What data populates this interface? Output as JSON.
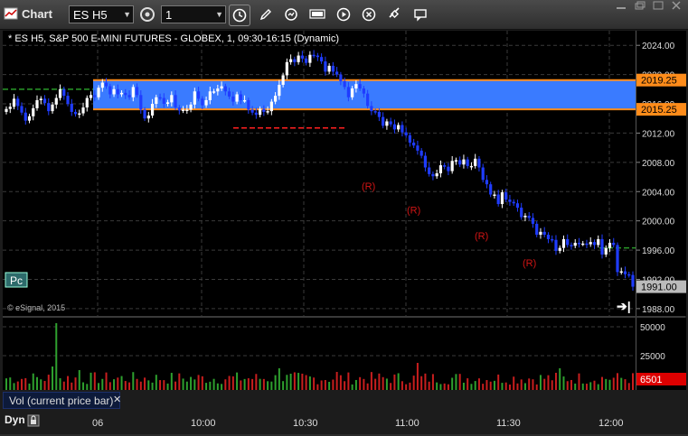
{
  "window": {
    "title": "Chart"
  },
  "toolbar": {
    "symbol": "ES H5",
    "interval": "1",
    "tools": [
      "properties-icon",
      "clock-icon",
      "draw-icon",
      "refresh-icon",
      "quote-icon",
      "play-icon",
      "search-icon",
      "link-icon",
      "message-icon"
    ]
  },
  "chart": {
    "header": "* ES H5, S&P 500 E-MINI FUTURES - GLOBEX, 1, 09:30-16:15 (Dynamic)",
    "copyright": "© eSignal, 2015",
    "pc_label": "Pc",
    "zone": {
      "upper": 2019.25,
      "lower": 2015.25,
      "color": "#3a7bff"
    },
    "last_price": "1991.00",
    "upper_label": "2019.25",
    "lower_label": "2015.25",
    "price_ticks": [
      "2024.00",
      "2020.00",
      "2016.00",
      "2012.00",
      "2008.00",
      "2004.00",
      "2000.00",
      "1996.00",
      "1992.00",
      "1988.00"
    ],
    "r_markers": [
      "(R)",
      "(R)",
      "(R)",
      "(R)"
    ],
    "chart_data": {
      "type": "candlestick",
      "ylim": [
        1987,
        2026
      ],
      "x": [
        "06",
        "10:00",
        "10:30",
        "11:00",
        "11:30",
        "12:00"
      ],
      "close": [
        2015.3,
        2015.6,
        2016.7,
        2015.7,
        2014.8,
        2013.7,
        2014.3,
        2015.4,
        2016.5,
        2016.7,
        2016.1,
        2015.0,
        2015.9,
        2016.8,
        2018.0,
        2017.1,
        2016.0,
        2014.9,
        2014.6,
        2014.7,
        2015.5,
        2016.8,
        2017.2,
        2016.9,
        2018.2,
        2018.9,
        2018.4,
        2017.3,
        2018.0,
        2017.3,
        2017.5,
        2017.2,
        2016.9,
        2018.3,
        2017.2,
        2015.2,
        2014.0,
        2014.4,
        2016.0,
        2016.9,
        2016.8,
        2016.0,
        2016.2,
        2017.2,
        2015.5,
        2015.1,
        2015.2,
        2015.2,
        2015.9,
        2017.7,
        2016.7,
        2015.8,
        2016.5,
        2017.7,
        2017.7,
        2018.1,
        2018.4,
        2017.7,
        2017.0,
        2016.3,
        2017.3,
        2016.5,
        2016.5,
        2015.2,
        2014.8,
        2014.5,
        2015.3,
        2014.9,
        2015.0,
        2016.3,
        2017.1,
        2018.6,
        2019.9,
        2021.7,
        2022.1,
        2021.7,
        2022.6,
        2022.2,
        2021.6,
        2022.7,
        2022.6,
        2022.4,
        2021.8,
        2020.4,
        2021.2,
        2020.4,
        2020.0,
        2019.1,
        2018.3,
        2016.9,
        2018.1,
        2018.7,
        2018.1,
        2017.4,
        2015.7,
        2015.0,
        2014.9,
        2014.2,
        2013.0,
        2013.6,
        2013.2,
        2012.5,
        2013.1,
        2012.1,
        2011.7,
        2010.7,
        2010.3,
        2009.6,
        2008.9,
        2007.3,
        2006.4,
        2006.1,
        2006.5,
        2007.6,
        2007.4,
        2006.8,
        2008.2,
        2008.3,
        2007.7,
        2008.4,
        2007.5,
        2007.5,
        2008.5,
        2007.3,
        2005.6,
        2005.0,
        2003.6,
        2003.6,
        2002.3,
        2003.9,
        2002.9,
        2002.6,
        2002.4,
        2001.8,
        2000.5,
        2000.7,
        2000.4,
        1999.6,
        1998.1,
        1998.5,
        1998.1,
        1997.5,
        1997.4,
        1995.9,
        1996.3,
        1997.5,
        1996.7,
        1996.6,
        1997.0,
        1996.9,
        1996.9,
        1996.8,
        1997.1,
        1996.7,
        1997.5,
        1995.4,
        1996.3,
        1997.0,
        1996.7,
        1993.0,
        1993.1,
        1992.7,
        1992.6,
        1991.0
      ],
      "volume": {
        "ylim": [
          0,
          60000
        ],
        "ticks": [
          "50000",
          "25000"
        ],
        "last": "6501"
      }
    }
  },
  "volume_panel": {
    "label": "Vol (current price bar)"
  },
  "footer": {
    "dyn": "Dyn"
  }
}
